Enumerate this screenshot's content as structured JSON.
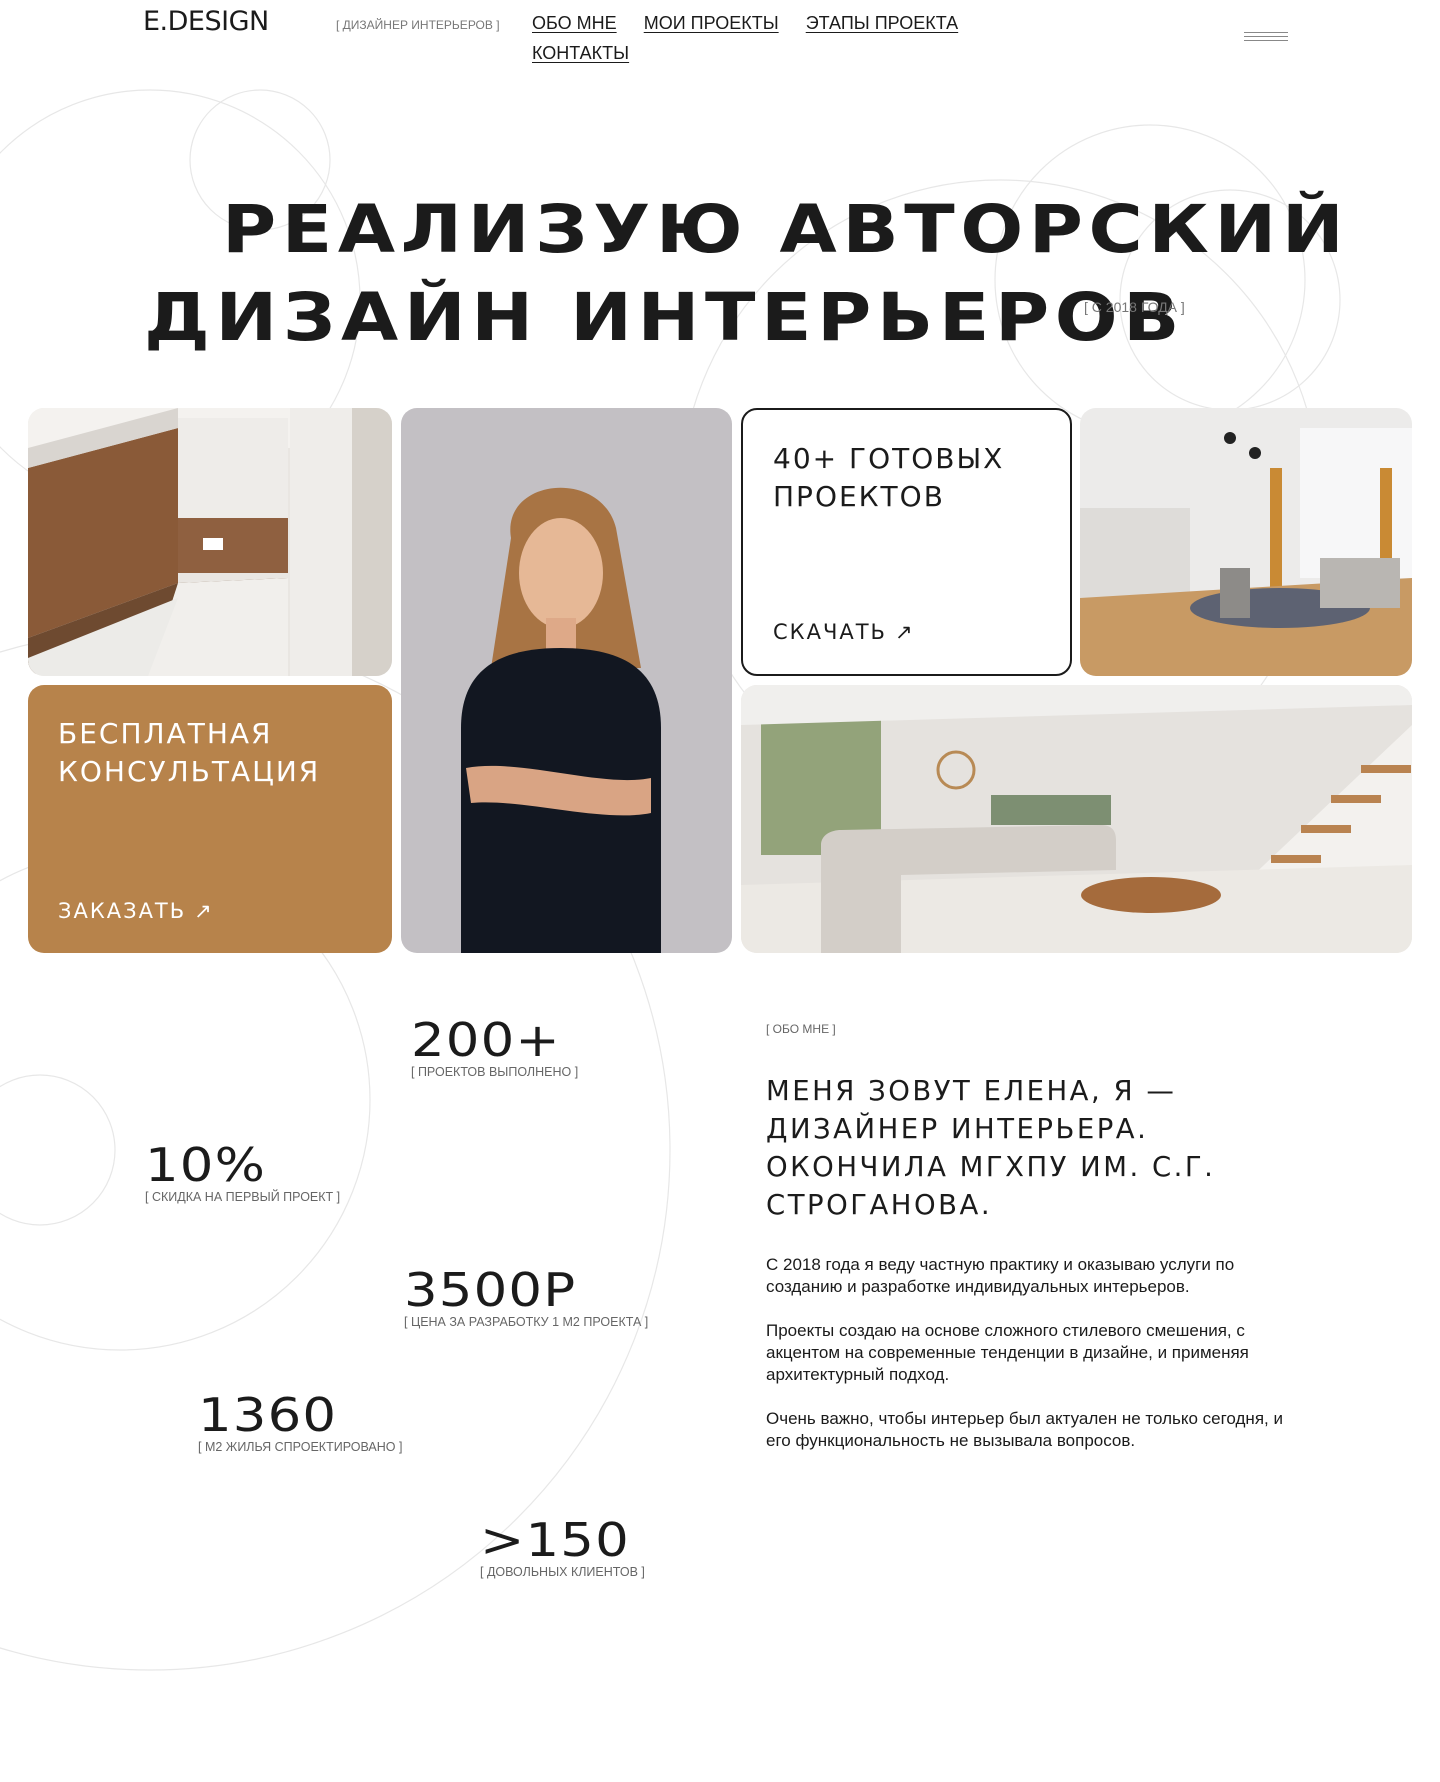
{
  "header": {
    "logo": "E.DESIGN",
    "tagline": "[ ДИЗАЙНЕР ИНТЕРЬЕРОВ ]",
    "nav": [
      "ОБО МНЕ",
      "МОИ ПРОЕКТЫ",
      "ЭТАПЫ ПРОЕКТА",
      "КОНТАКТЫ"
    ],
    "menu_icon": "hamburger-icon"
  },
  "hero": {
    "title_line1": "РЕАЛИЗУЮ АВТОРСКИЙ",
    "title_line2": "ДИЗАЙН ИНТЕРЬЕРОВ",
    "since": "[ С 2018 ГОДА ]"
  },
  "gallery": {
    "projects_card": {
      "title": "40+ ГОТОВЫХ\nПРОЕКТОВ",
      "link": "СКАЧАТЬ",
      "arrow": "↗"
    },
    "consult_card": {
      "title": "БЕСПЛАТНАЯ\nКОНСУЛЬТАЦИЯ",
      "link": "ЗАКАЗАТЬ",
      "arrow": "↗"
    },
    "accent_color": "#b7834b"
  },
  "stats": [
    {
      "value": "200+",
      "label": "[ ПРОЕКТОВ ВЫПОЛНЕНО ]"
    },
    {
      "value": "10%",
      "label": "[ СКИДКА НА ПЕРВЫЙ ПРОЕКТ ]"
    },
    {
      "value": "3500Р",
      "label": "[ ЦЕНА ЗА РАЗРАБОТКУ 1 М2 ПРОЕКТА ]"
    },
    {
      "value": "1360",
      "label": "[ М2 ЖИЛЬЯ СПРОЕКТИРОВАНО ]"
    },
    {
      "value": ">150",
      "label": "[ ДОВОЛЬНЫХ КЛИЕНТОВ ]"
    }
  ],
  "about": {
    "tag": "[ ОБО МНЕ ]",
    "heading": "МЕНЯ ЗОВУТ ЕЛЕНА, Я — ДИЗАЙНЕР ИНТЕРЬЕРА. ОКОНЧИЛА МГХПУ ИМ. С.Г. СТРОГАНОВА.",
    "paragraphs": [
      "С 2018 года я веду частную практику и оказываю услуги по созданию и разработке индивидуальных интерьеров.",
      "Проекты создаю на основе сложного стилевого смешения, с акцентом на современные тенденции в дизайне, и применяя архитектурный подход.",
      "Очень важно, чтобы интерьер был актуален не только сегодня, и его функциональность не вызывала вопросов."
    ]
  }
}
